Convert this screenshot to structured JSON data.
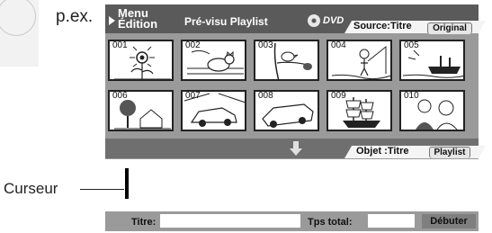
{
  "example_label": "p.ex.",
  "header": {
    "menu_line1": "Menu",
    "menu_line2": "Édition",
    "title": "Pré-visu Playlist",
    "dvd_label": "DVD",
    "source_label": "Source:Titre",
    "original_button": "Original"
  },
  "thumbnails": [
    {
      "number": "001",
      "icon": "sunflower"
    },
    {
      "number": "002",
      "icon": "cat"
    },
    {
      "number": "003",
      "icon": "bird-on-branch"
    },
    {
      "number": "004",
      "icon": "fisherman"
    },
    {
      "number": "005",
      "icon": "ship-at-sea"
    },
    {
      "number": "006",
      "icon": "house-with-tree"
    },
    {
      "number": "007",
      "icon": "car"
    },
    {
      "number": "008",
      "icon": "sedan"
    },
    {
      "number": "009",
      "icon": "sailing-ship"
    },
    {
      "number": "010",
      "icon": "people"
    }
  ],
  "object": {
    "label": "Objet :Titre",
    "playlist_button": "Playlist"
  },
  "footer": {
    "title_label": "Titre:",
    "title_value": "",
    "total_time_label": "Tps total:",
    "total_time_value": "",
    "start_button": "Débuter"
  },
  "cursor_label": "Curseur"
}
